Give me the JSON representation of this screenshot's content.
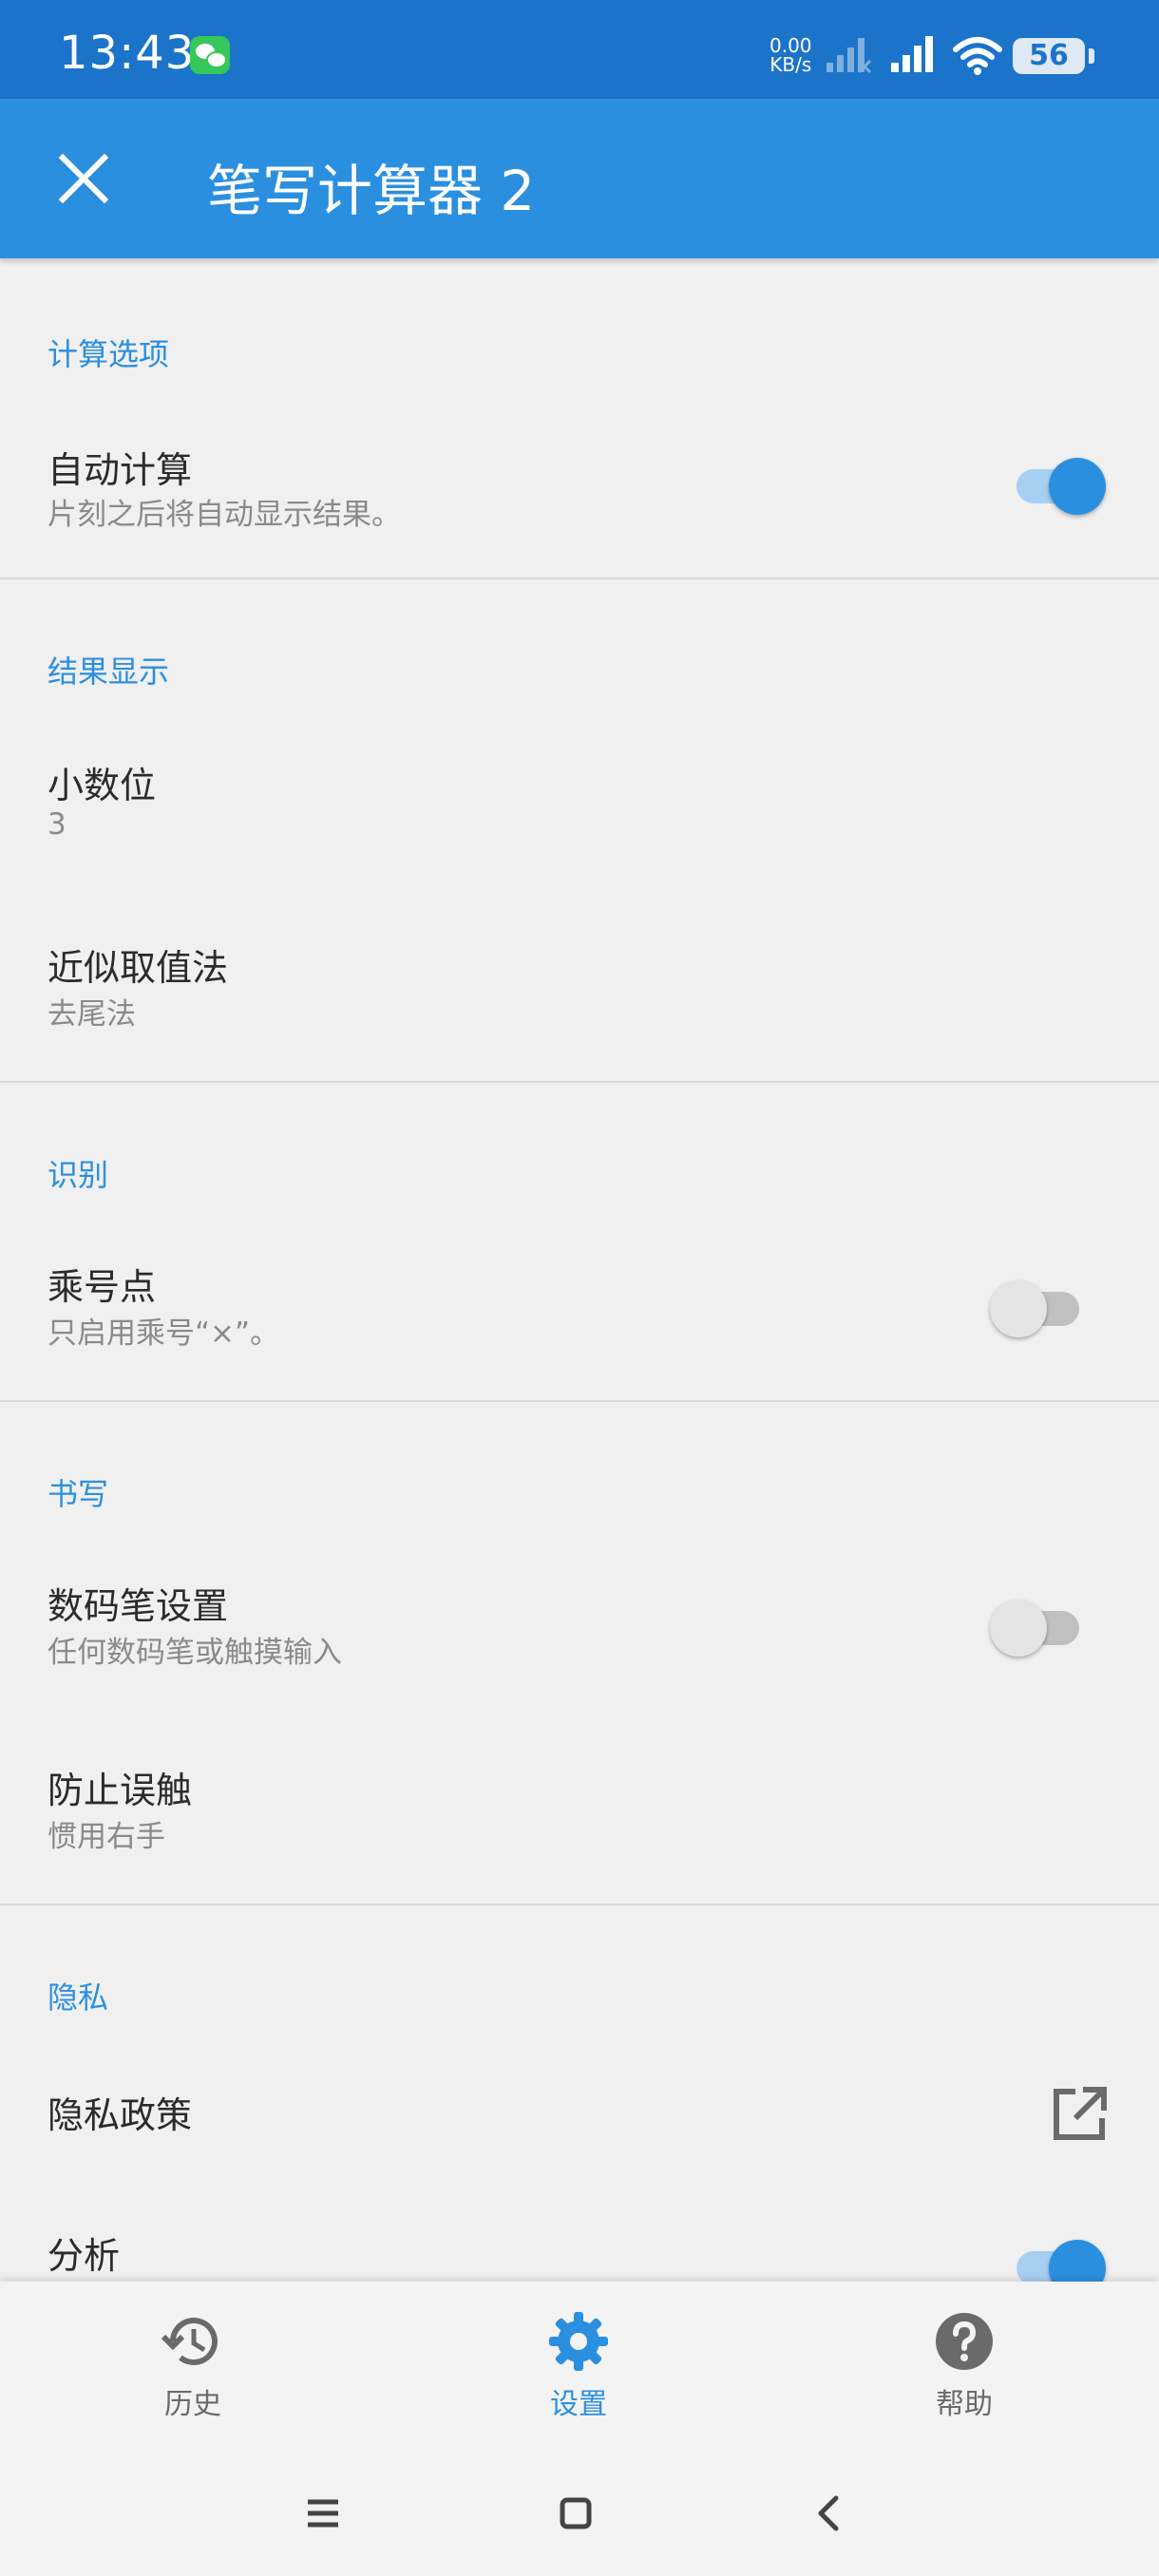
{
  "status_bar": {
    "time": "13:43",
    "net_speed_value": "0.00",
    "net_speed_unit": "KB/s",
    "battery": "56",
    "icons": [
      "wechat-icon",
      "signal-icon",
      "wifi-icon",
      "battery-icon"
    ]
  },
  "app_bar": {
    "title": "笔写计算器 2",
    "close_icon": "close-icon"
  },
  "sections": {
    "calc": {
      "header": "计算选项",
      "auto_calc": {
        "title": "自动计算",
        "summary": "片刻之后将自动显示结果。",
        "enabled": true
      }
    },
    "result": {
      "header": "结果显示",
      "decimals": {
        "title": "小数位",
        "summary": "3"
      },
      "rounding": {
        "title": "近似取值法",
        "summary": "去尾法"
      }
    },
    "recognition": {
      "header": "识别",
      "multiply_dot": {
        "title": "乘号点",
        "summary": "只启用乘号“×”。",
        "enabled": false
      }
    },
    "writing": {
      "header": "书写",
      "stylus": {
        "title": "数码笔设置",
        "summary": "任何数码笔或触摸输入",
        "enabled": false
      },
      "palm": {
        "title": "防止误触",
        "summary": "惯用右手"
      }
    },
    "privacy": {
      "header": "隐私",
      "policy": {
        "title": "隐私政策",
        "icon": "external-link-icon"
      },
      "analytics": {
        "title": "分析",
        "enabled": true
      }
    }
  },
  "bottom_nav": {
    "history": {
      "label": "历史",
      "icon": "history-icon"
    },
    "settings": {
      "label": "设置",
      "icon": "gear-icon"
    },
    "help": {
      "label": "帮助",
      "icon": "help-icon"
    }
  },
  "colors": {
    "status_bar": "#1b74c9",
    "app_bar": "#2b8fe0",
    "accent": "#2b8fe0",
    "background": "#f0f0f0"
  }
}
